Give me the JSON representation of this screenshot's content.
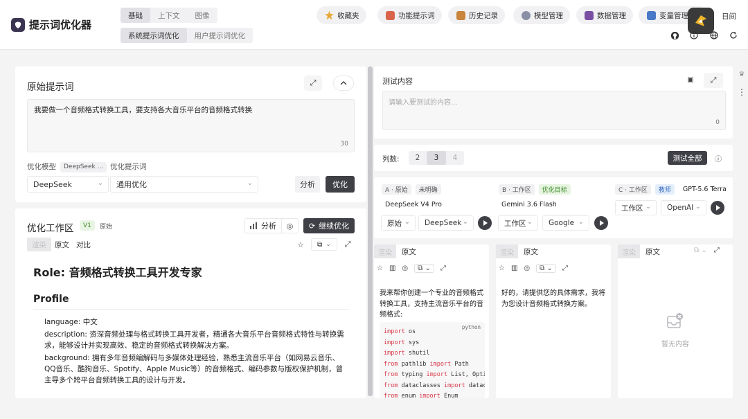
{
  "header": {
    "app_title": "提示词优化器",
    "mode_tabs": [
      "基础",
      "上下文",
      "图像"
    ],
    "sub_tabs": [
      "系统提示词优化",
      "用户提示词优化"
    ],
    "nav": [
      {
        "label": "收藏夹",
        "color": "#e8a93a"
      },
      {
        "label": "功能提示词",
        "color": "#d9644c"
      },
      {
        "label": "历史记录",
        "color": "#c9853b"
      },
      {
        "label": "模型管理",
        "color": "#8b8fa6"
      },
      {
        "label": "数据管理",
        "color": "#7a4fa3"
      },
      {
        "label": "变量管理",
        "color": "#4a78c8"
      }
    ],
    "theme_label": "日间"
  },
  "original": {
    "title": "原始提示词",
    "text": "我要做一个音频格式转换工具，要支持各大音乐平台的音频格式转换",
    "char_count": "30",
    "model_label": "优化模型",
    "model_tag": "DeepSeek ...",
    "template_label": "优化提示词",
    "model_value": "DeepSeek",
    "template_value": "通用优化",
    "analyze_label": "分析",
    "optimize_label": "优化"
  },
  "workspace": {
    "title": "优化工作区",
    "version": "V1",
    "version_tag": "原始",
    "analyze_label": "分析",
    "continue_label": "继续优化",
    "view_tabs": [
      "渲染",
      "原文",
      "对比"
    ],
    "h1": "Role: 音频格式转换工具开发专家",
    "h2": "Profile",
    "lines": [
      "language: 中文",
      "description: 资深音频处理与格式转换工具开发者，精通各大音乐平台音频格式特性与转换需求，能够设计并实现高效、稳定的音频格式转换解决方案。",
      "background: 拥有多年音频编解码与多媒体处理经验，熟悉主流音乐平台（如网易云音乐、QQ音乐、酷狗音乐、Spotify、Apple Music等）的音频格式、编码参数与版权保护机制，曾主导多个跨平台音频转换工具的设计与开发。"
    ]
  },
  "test": {
    "title": "测试内容",
    "placeholder": "请输入要测试的内容...",
    "char_count": "0",
    "columns_label": "列数:",
    "column_options": [
      "2",
      "3",
      "4"
    ],
    "test_all_label": "测试全部"
  },
  "columns": [
    {
      "slot": "A · 原始",
      "tag": "未明确",
      "model": "DeepSeek V4 Pro",
      "sel1": "原始",
      "sel2": "DeepSeek",
      "view_tabs": [
        "渲染",
        "原文"
      ],
      "output": "我来帮你创建一个专业的音频格式转换工具，支持主流音乐平台的音频格式:",
      "code_lang": "python",
      "code": [
        [
          [
            "import",
            "kw"
          ],
          [
            " os",
            ""
          ]
        ],
        [
          [
            "import",
            "kw"
          ],
          [
            " sys",
            ""
          ]
        ],
        [
          [
            "import",
            "kw"
          ],
          [
            " shutil",
            ""
          ]
        ],
        [
          [
            "from",
            "kw"
          ],
          [
            " pathlib ",
            ""
          ],
          [
            "import",
            "kw"
          ],
          [
            " Path",
            ""
          ]
        ],
        [
          [
            "from",
            "kw"
          ],
          [
            " typing ",
            ""
          ],
          [
            "import",
            "kw"
          ],
          [
            " List, Optio",
            ""
          ]
        ],
        [
          [
            "from",
            "kw"
          ],
          [
            " dataclasses ",
            ""
          ],
          [
            "import",
            "kw"
          ],
          [
            " datacl",
            ""
          ]
        ],
        [
          [
            "from",
            "kw"
          ],
          [
            " enum ",
            ""
          ],
          [
            "import",
            "kw"
          ],
          [
            " Enum",
            ""
          ]
        ]
      ]
    },
    {
      "slot": "B · 工作区",
      "tag": "优化目标",
      "model": "Gemini 3.6 Flash",
      "sel1": "工作区",
      "sel2": "Google",
      "view_tabs": [
        "渲染",
        "原文"
      ],
      "output": "好的，请提供您的具体需求，我将为您设计音频格式转换方案。"
    },
    {
      "slot": "C · 工作区",
      "tag": "教师",
      "model": "GPT-5.6 Terra",
      "sel1": "工作区",
      "sel2": "OpenAI",
      "view_tabs": [
        "渲染",
        "原文"
      ],
      "empty_label": "暂无内容"
    }
  ]
}
